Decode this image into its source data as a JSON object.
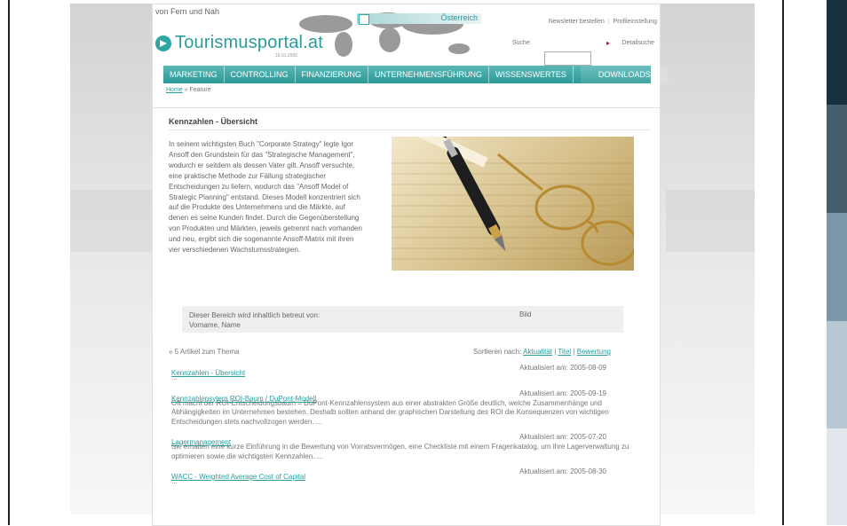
{
  "colors": {
    "accent": "#2a9c9b",
    "nav": "#2b9897"
  },
  "swatches": [
    "#16303e",
    "#445e6e",
    "#7b97a9",
    "#b7c8d3",
    "#e1e7ec"
  ],
  "header": {
    "tagline": "von Fern und Nah",
    "logo_text": "Tourismusportal.at",
    "logo_date": "16.01.2005",
    "region": "Österreich",
    "toplinks": [
      "Newsletter bestellen",
      "Profileinstellung"
    ],
    "search_label": "Suche",
    "detail_search": "Detailsuche",
    "nav": [
      "MARKETING",
      "CONTROLLING",
      "FINANZIERUNG",
      "UNTERNEHMENSFÜHRUNG",
      "WISSENSWERTES",
      "DOWNLOADS"
    ],
    "breadcrumb": {
      "home": "Home",
      "sep": "»",
      "current": "Feature"
    }
  },
  "content": {
    "title": "Kennzahlen - Übersicht",
    "intro": "In seinem wichtigsten Buch \"Corporate Strategy\" legte Igor Ansoff den Grundstein für das \"Strategische Management\", wodurch er seitdem als dessen Vater gilt. Ansoff versuchte, eine praktische Methode zur Fällung strategischer Entscheidungen zu liefern, wodurch das \"Ansoff Model of Strategic Planning\" entstand. Dieses Modell konzentriert sich auf die Produkte des Unternehmens und die Märkte, auf denen es seine Kunden findet. Durch die Gegenüberstellung von Produkten und Märkten, jeweils getrennt nach vorhanden und neu, ergibt sich die sogenannte Ansoff-Matrix mit ihren vier verschiedenen Wachstumsstrategien.",
    "contact_line1": "Dieser Bereich wird inhaltlich betreut von:",
    "contact_line2": "Vorname, Name",
    "contact_image": "Bild",
    "count": "» 5 Artikel zum Thema",
    "sort_label": "Sortieren nach:",
    "sort_options": [
      "Aktualität",
      "Titel",
      "Bewertung"
    ],
    "articles": [
      {
        "title": "Kennzahlen - Übersicht",
        "updated": "Aktualisiert am: 2005-08-09",
        "desc": "..."
      },
      {
        "title": "Kennzahlensytem ROI-Baum / DuPont-Modell",
        "updated": "Aktualisiert am: 2005-09-19",
        "desc": "Oft macht der ROI-Entscheidungsbaum = DuPont-Kennzahlensystem aus einer abstrakten Größe deutlich, welche Zusammenhänge und Abhängigkeiten im Unternehmen bestehen. Deshalb sollten anhand der graphischen Darstellung des ROI die Konsequenzen von wichtigen Entscheidungen stets nachvollzogen werden. ..."
      },
      {
        "title": "Lagermanagement",
        "updated": "Aktualisiert am: 2005-07-20",
        "desc": "Sie erhalten eine kurze Einführung in die Bewertung von Vorratsvermögen, eine Checkliste mit einem Fragenkatalog, um Ihre Lagerverwaltung zu optimieren sowie die wichtigsten Kennzahlen. ..."
      },
      {
        "title": "WACC - Weighted Average Cost of Capital",
        "updated": "Aktualisiert am: 2005-08-30",
        "desc": "..."
      }
    ]
  }
}
